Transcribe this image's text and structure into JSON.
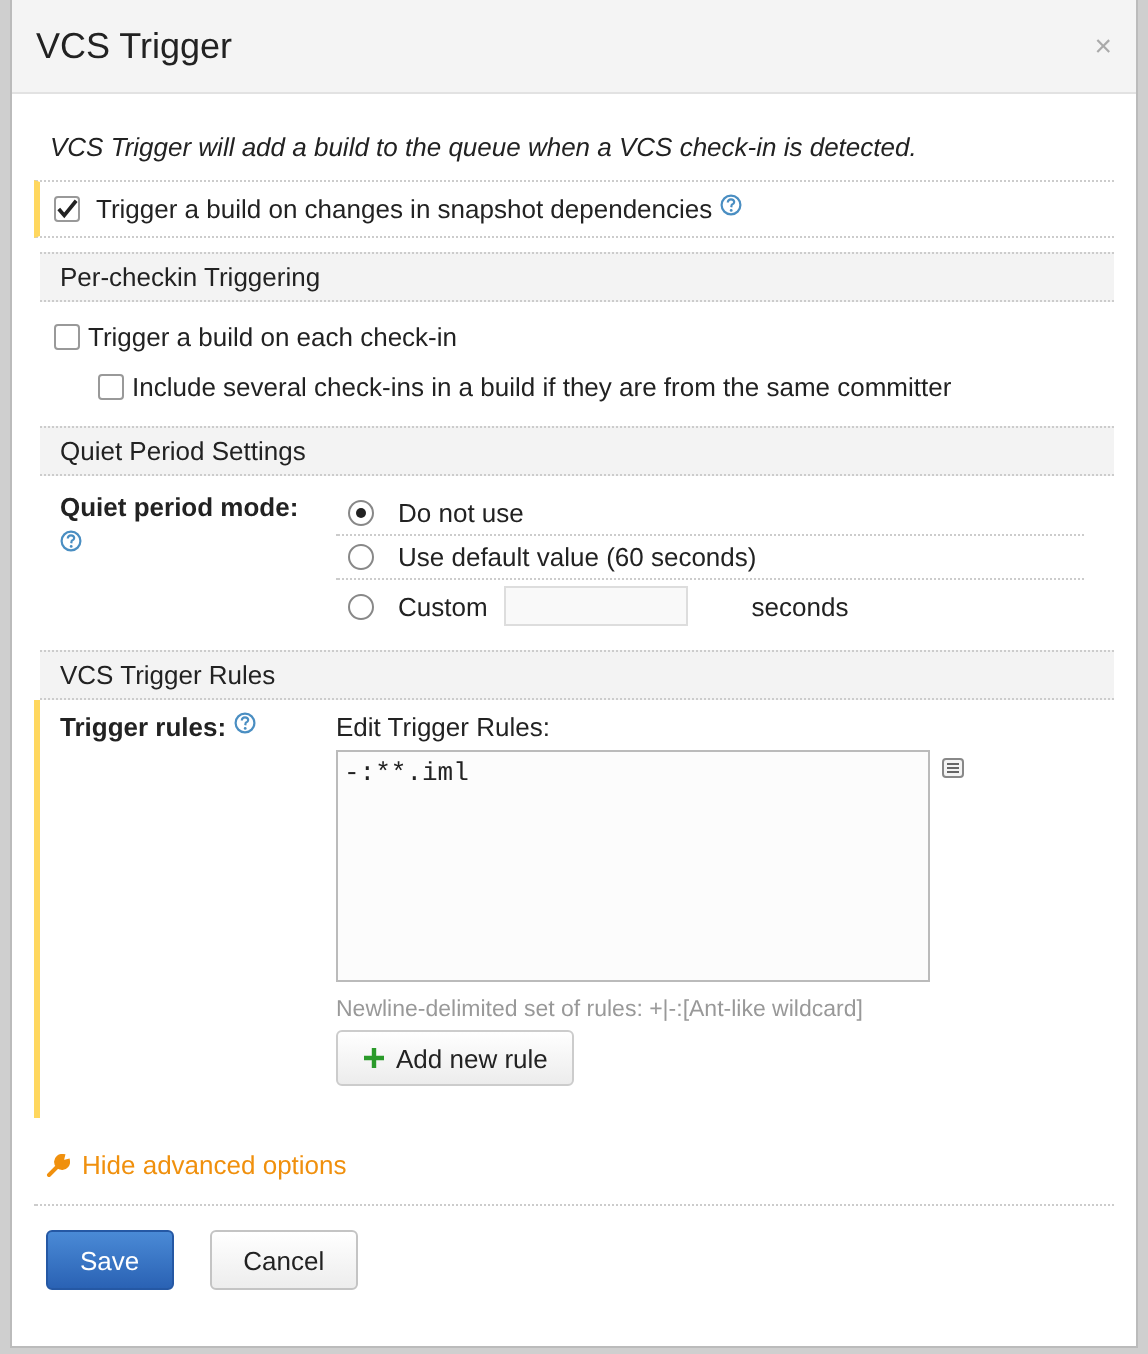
{
  "dialog": {
    "title": "VCS Trigger",
    "close": "×"
  },
  "description": "VCS Trigger will add a build to the queue when a VCS check-in is detected.",
  "snapshot_option": {
    "label": "Trigger a build on changes in snapshot dependencies",
    "checked": true,
    "modified": true
  },
  "sections": [
    {
      "kind": "checkboxes",
      "title": "Per-checkin Triggering",
      "options": [
        {
          "label": "Trigger a build on each check-in",
          "checked": false,
          "children": [
            {
              "label": "Include several check-ins in a build if they are from the same committer",
              "checked": false
            }
          ]
        }
      ]
    },
    {
      "kind": "radios",
      "title": "Quiet Period Settings",
      "label": "Quiet period mode:",
      "options": [
        {
          "label": "Do not use",
          "selected": true
        },
        {
          "label": "Use default value (60 seconds)",
          "selected": false
        },
        {
          "label": "Custom",
          "selected": false,
          "unit": "seconds"
        }
      ]
    },
    {
      "kind": "rules",
      "title": "VCS Trigger Rules",
      "label": "Trigger rules:",
      "modified": true,
      "editor_label": "Edit Trigger Rules:",
      "value": "-:**.iml",
      "hint": "Newline-delimited set of rules: +|-:[Ant-like wildcard]",
      "add_button": "Add new rule"
    }
  ],
  "advanced_link": "Hide advanced options",
  "buttons": [
    {
      "label": "Save",
      "kind": "primary"
    },
    {
      "label": "Cancel",
      "kind": "secondary"
    }
  ]
}
